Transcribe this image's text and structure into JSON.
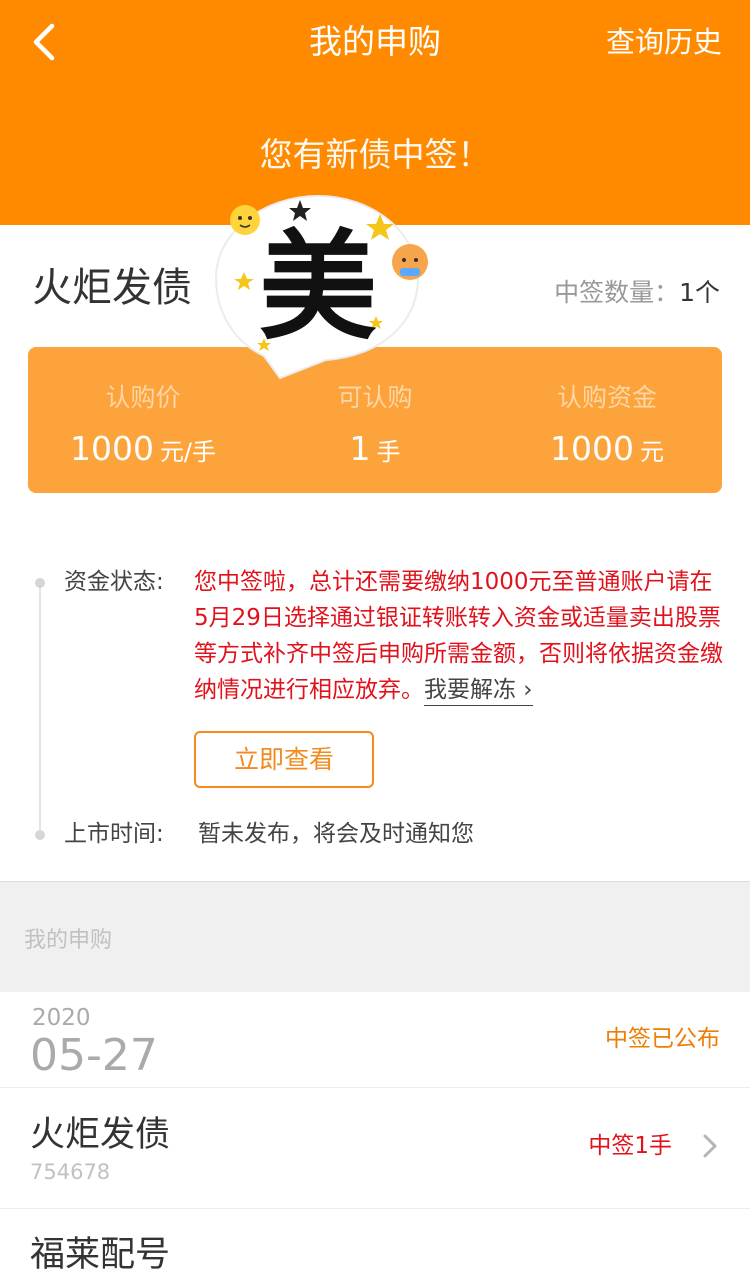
{
  "nav": {
    "title": "我的申购",
    "right_link": "查询历史"
  },
  "banner": {
    "text": "您有新债中签！"
  },
  "bond": {
    "name": "火炬发债",
    "lot_label": "中签数量：",
    "lot_value": "1个"
  },
  "sticker": {
    "glyph": "美"
  },
  "info": [
    {
      "label": "认购价",
      "value": "1000",
      "unit": "元/手"
    },
    {
      "label": "可认购",
      "value": "1",
      "unit": "手"
    },
    {
      "label": "认购资金",
      "value": "1000",
      "unit": "元"
    }
  ],
  "status": {
    "label": "资金状态:",
    "text": "您中签啦，总计还需要缴纳1000元至普通账户请在5月29日选择通过银证转账转入资金或适量卖出股票等方式补齐中签后申购所需金额，否则将依据资金缴纳情况进行相应放弃。",
    "link": "我要解冻 ›",
    "button": "立即查看"
  },
  "listing": {
    "label": "上市时间:",
    "text": "暂未发布，将会及时通知您"
  },
  "section": {
    "title": "我的申购"
  },
  "record_group": {
    "year": "2020",
    "month_day": "05-27",
    "status": "中签已公布"
  },
  "records": [
    {
      "name": "火炬发债",
      "code": "754678",
      "result": "中签1手"
    },
    {
      "name": "福莱配号"
    }
  ],
  "colors": {
    "primary": "#ff8a00",
    "card": "#fca33c",
    "alert": "#e0131d",
    "accent": "#ee7d05"
  }
}
